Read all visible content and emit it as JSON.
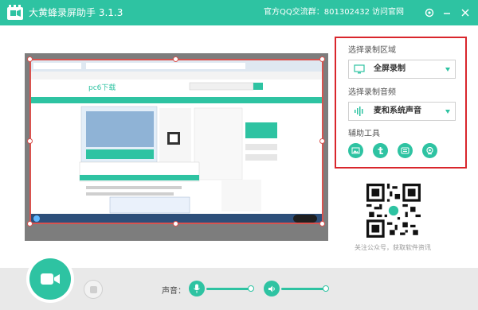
{
  "app": {
    "title": "大黄蜂录屏助手 3.1.3",
    "qq_group": "官方QQ交流群：801302432",
    "visit_site": "访问官网"
  },
  "panel": {
    "region_label": "选择录制区域",
    "region_value": "全屏录制",
    "audio_label": "选择录制音频",
    "audio_value": "麦和系统声音",
    "tools_label": "辅助工具"
  },
  "qr": {
    "caption": "关注公众号，获取软件资讯"
  },
  "bottom": {
    "volume_label": "声音："
  },
  "preview": {
    "site_logo": "pc6下载"
  },
  "colors": {
    "accent": "#2ec3a2",
    "highlight_border": "#d9262c"
  },
  "icons": {
    "titlebar": [
      "app-logo-icon",
      "settings-icon",
      "minimize-icon",
      "close-icon"
    ],
    "tools": [
      "image-icon",
      "text-icon",
      "subtitle-icon",
      "camera-icon"
    ],
    "bottom": [
      "video-camera-icon",
      "stop-icon",
      "microphone-icon",
      "speaker-icon"
    ]
  }
}
